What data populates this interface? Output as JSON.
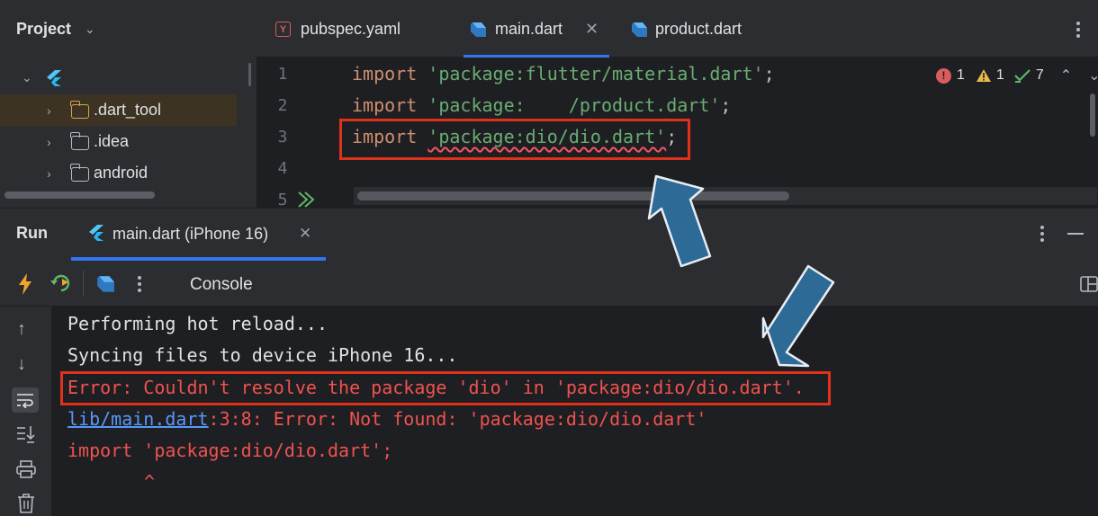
{
  "project": {
    "title": "Project",
    "tree": [
      ".dart_tool",
      ".idea",
      "android"
    ]
  },
  "editor": {
    "tabs": [
      {
        "name": "pubspec.yaml",
        "icon": "yaml-icon"
      },
      {
        "name": "main.dart",
        "icon": "dart-file-icon",
        "active": true
      },
      {
        "name": "product.dart",
        "icon": "dart-file-icon"
      }
    ],
    "line_numbers": [
      "1",
      "2",
      "3",
      "4",
      "5"
    ],
    "lines": [
      {
        "kw": "import",
        "str": "'package:flutter/material.dart'",
        "end": ";"
      },
      {
        "kw": "import",
        "str": "'package:    /product.dart'",
        "end": ";"
      },
      {
        "kw": "import",
        "str": "'package:dio/dio.dart'",
        "end": ";"
      }
    ],
    "inspections": {
      "errors": "1",
      "warnings": "1",
      "ok": "7"
    }
  },
  "run": {
    "title": "Run",
    "tab_label": "main.dart (iPhone 16)",
    "console_label": "Console",
    "console": {
      "line1": "Performing hot reload...",
      "line2": "Syncing files to device iPhone 16...",
      "line3": "Error: Couldn't resolve the package 'dio' in 'package:dio/dio.dart'.",
      "line4_link": "lib/main.dart",
      "line4_rest": ":3:8: Error: Not found: 'package:dio/dio.dart'",
      "line5": "import 'package:dio/dio.dart';",
      "line6": "^"
    }
  },
  "colors": {
    "annotation_box": "#e0311a",
    "arrow": "#2e6a96",
    "accent": "#3574f0"
  }
}
